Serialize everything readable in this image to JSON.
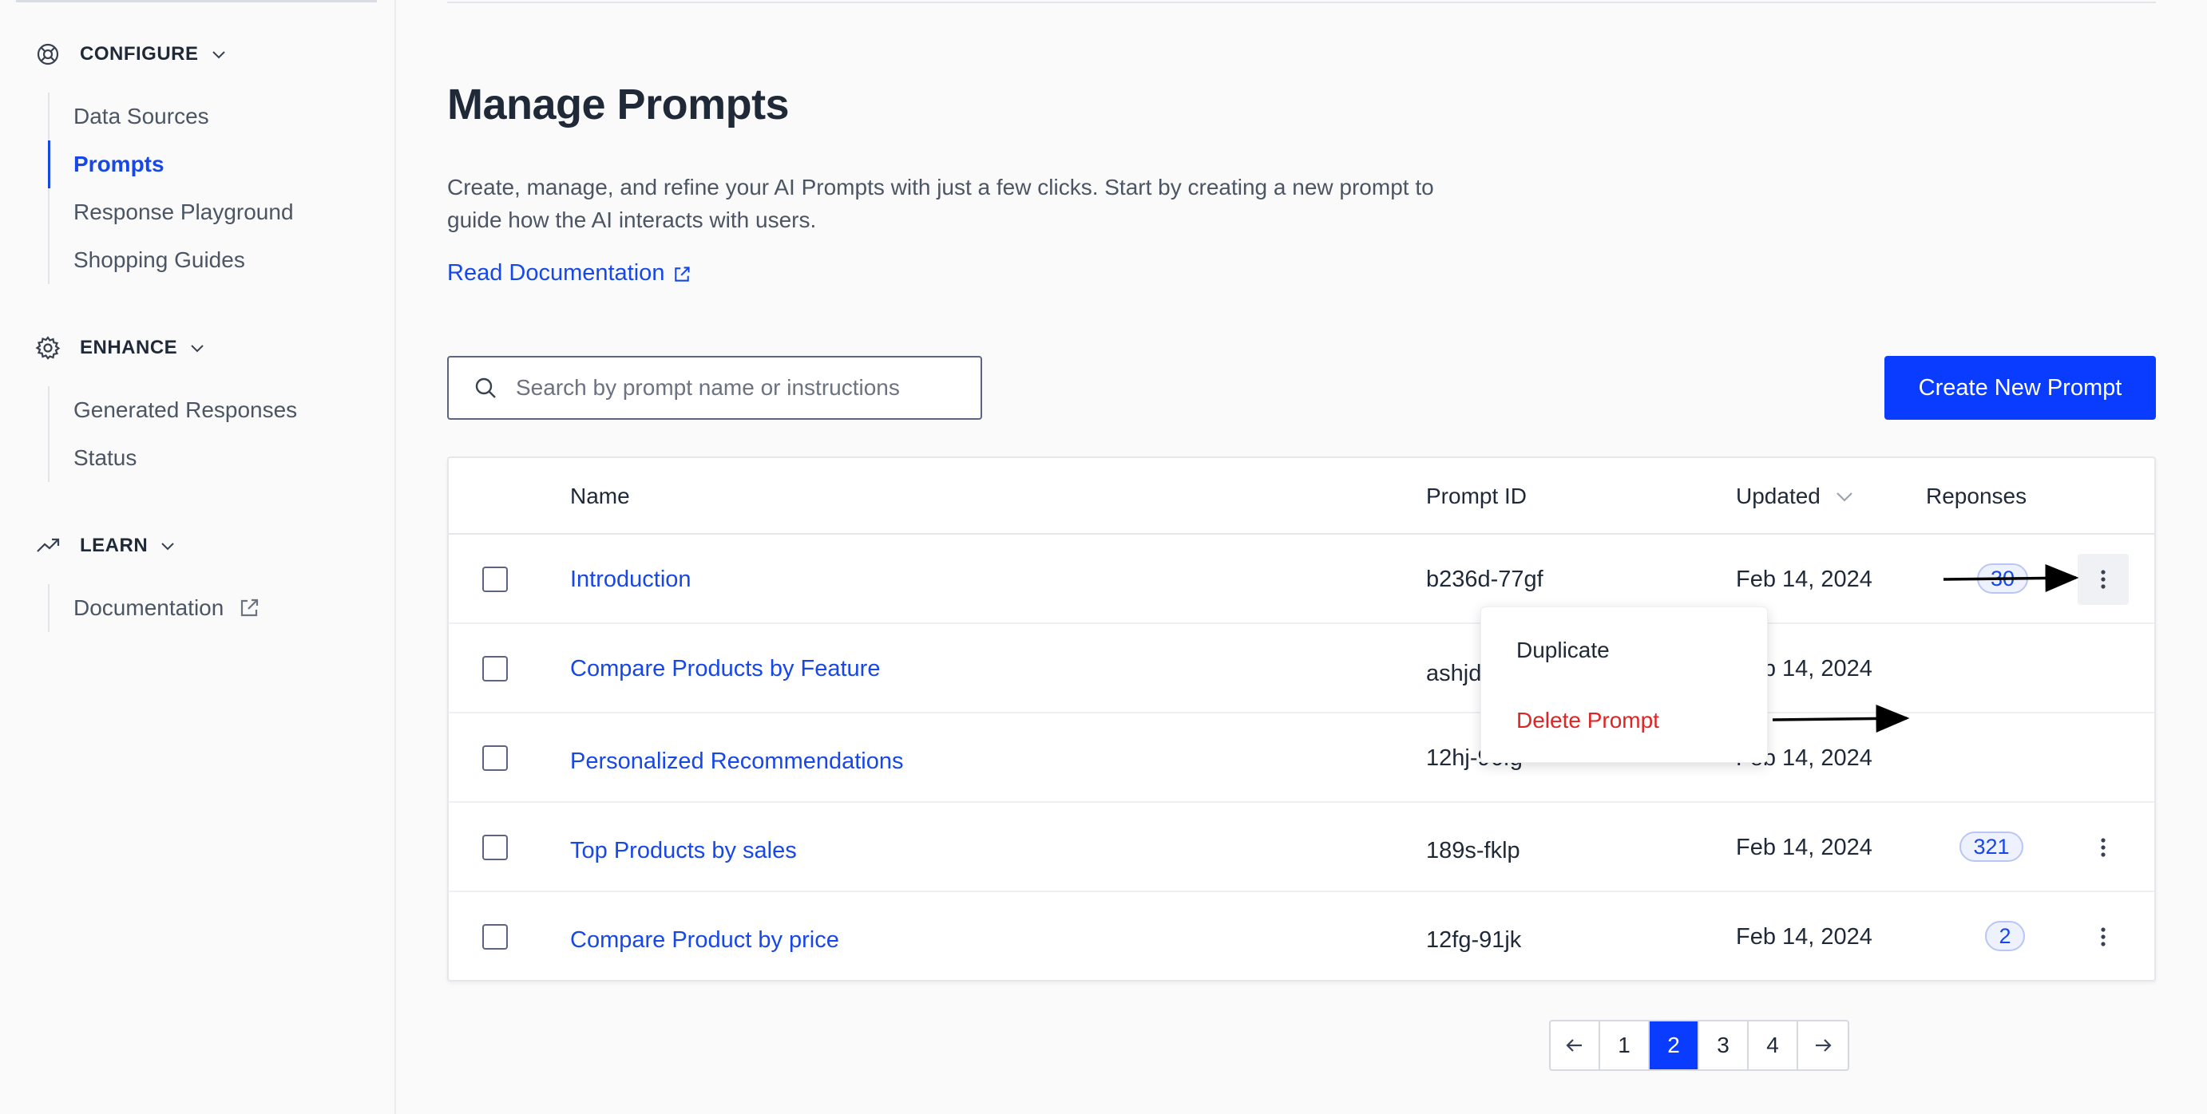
{
  "sidebar": {
    "sections": [
      {
        "title": "CONFIGURE",
        "icon": "lifebuoy-icon",
        "items": [
          {
            "label": "Data Sources",
            "active": false
          },
          {
            "label": "Prompts",
            "active": true
          },
          {
            "label": "Response Playground",
            "active": false
          },
          {
            "label": "Shopping Guides",
            "active": false
          }
        ]
      },
      {
        "title": "ENHANCE",
        "icon": "gear-icon",
        "items": [
          {
            "label": "Generated Responses",
            "active": false
          },
          {
            "label": "Status",
            "active": false
          }
        ]
      },
      {
        "title": "LEARN",
        "icon": "trending-up-icon",
        "items": [
          {
            "label": "Documentation",
            "active": false,
            "external": true
          }
        ]
      }
    ]
  },
  "main": {
    "title": "Manage Prompts",
    "description": "Create, manage, and refine your AI Prompts with just a few clicks. Start by creating a new prompt to guide how the AI interacts with users.",
    "doc_link": "Read Documentation",
    "search_placeholder": "Search by prompt name or instructions",
    "search_value": "",
    "create_button": "Create New Prompt"
  },
  "table": {
    "columns": {
      "name": "Name",
      "prompt_id": "Prompt ID",
      "updated": "Updated",
      "responses": "Reponses"
    },
    "rows": [
      {
        "name": "Introduction",
        "prompt_id": "b236d-77gf",
        "updated": "Feb 14, 2024",
        "responses": "30"
      },
      {
        "name": "Compare Products by Feature",
        "prompt_id": "ashjd-22hh",
        "updated": "Feb 14, 2024",
        "responses": ""
      },
      {
        "name": "Personalized Recommendations",
        "prompt_id": "12hj-96fg",
        "updated": "Feb 14, 2024",
        "responses": ""
      },
      {
        "name": "Top Products by sales",
        "prompt_id": "189s-fklp",
        "updated": "Feb 14, 2024",
        "responses": "321"
      },
      {
        "name": "Compare Product by price",
        "prompt_id": "12fg-91jk",
        "updated": "Feb 14, 2024",
        "responses": "2"
      }
    ]
  },
  "menu": {
    "duplicate": "Duplicate",
    "delete": "Delete Prompt"
  },
  "pagination": {
    "pages": [
      "1",
      "2",
      "3",
      "4"
    ],
    "current": "2"
  },
  "colors": {
    "accent": "#0a3cff",
    "link": "#1747e6",
    "danger": "#dc2626"
  }
}
